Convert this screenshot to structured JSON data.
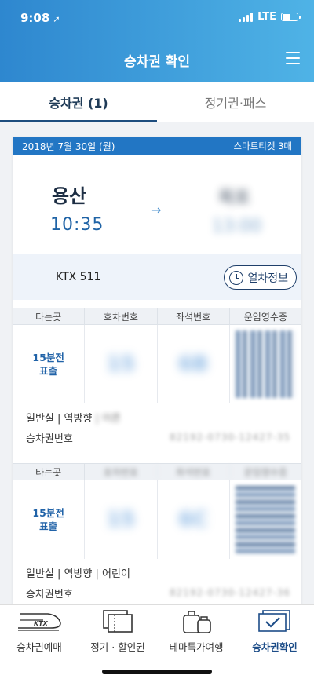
{
  "status": {
    "time": "9:08",
    "network": "LTE"
  },
  "header": {
    "title": "승차권 확인"
  },
  "tabs": [
    {
      "label": "승차권 (1)"
    },
    {
      "label": "정기권·패스"
    }
  ],
  "ticket": {
    "date": "2018년 7월 30일 (월)",
    "smart_ticket": "스마트티켓 3매",
    "departure": {
      "station": "용산",
      "time": "10:35"
    },
    "arrival": {
      "station": "목포",
      "time": "13:00"
    },
    "train": "KTX 511",
    "info_button": "열차정보",
    "columns": [
      "타는곳",
      "호차번호",
      "좌석번호",
      "운임영수증"
    ],
    "rows": [
      {
        "boarding_line1": "15분전",
        "boarding_line2": "표출",
        "car": "15",
        "seat": "6B",
        "meta_main": "일반실 | 역방향",
        "meta_extra": " | 어른",
        "ticket_label": "승차권번호",
        "ticket_number": "82192-0730-12427-35"
      },
      {
        "boarding_line1": "15분전",
        "boarding_line2": "표출",
        "car": "15",
        "seat": "6C",
        "meta_main": "일반실 | 역방향 | 어린이",
        "ticket_label": "승차권번호",
        "ticket_number": "82192-0730-12427-36"
      }
    ]
  },
  "bottom_nav": [
    {
      "label": "승차권예매",
      "icon": "ktx-train-icon"
    },
    {
      "label": "정기 · 할인권",
      "icon": "pass-ticket-icon"
    },
    {
      "label": "테마특가여행",
      "icon": "luggage-icon"
    },
    {
      "label": "승차권확인",
      "icon": "ticket-check-icon"
    }
  ],
  "colors": {
    "header_start": "#2e87cf",
    "header_end": "#4fb3e6",
    "card_head": "#2276c4",
    "accent": "#1d4d88"
  }
}
